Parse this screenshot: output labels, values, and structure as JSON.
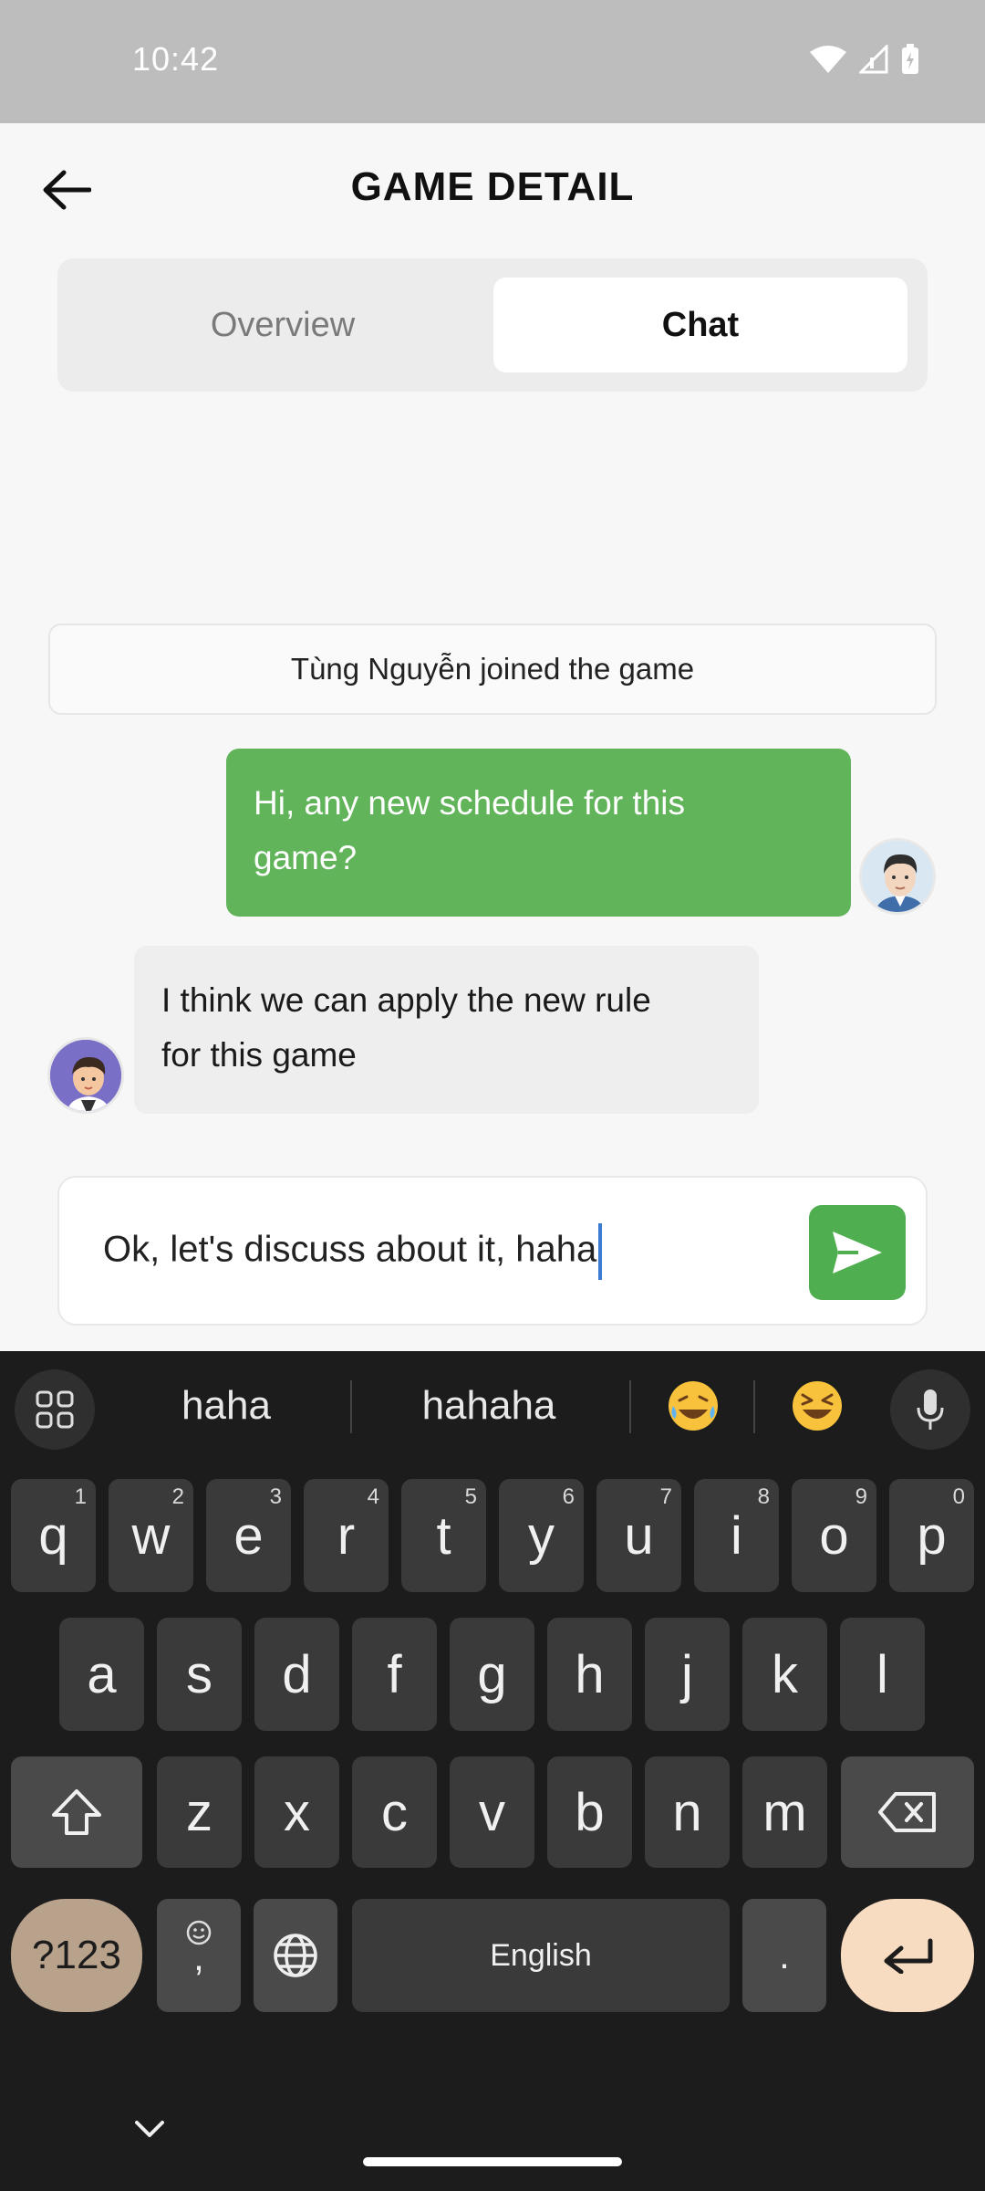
{
  "status_bar": {
    "time": "10:42"
  },
  "header": {
    "title": "GAME DETAIL"
  },
  "tabs": [
    {
      "label": "Overview"
    },
    {
      "label": "Chat"
    }
  ],
  "chat": {
    "system_message": "Tùng Nguyễn joined the game",
    "messages": [
      {
        "direction": "outgoing",
        "lines": [
          "Hi, any new schedule for this",
          "game?"
        ]
      },
      {
        "direction": "incoming",
        "lines": [
          "I think we can apply the new rule",
          "for this game"
        ]
      }
    ]
  },
  "composer": {
    "value": "Ok, let's discuss about it, haha"
  },
  "keyboard": {
    "suggestions": [
      "haha",
      "hahaha"
    ],
    "emojis": [
      "face-with-tears-of-joy",
      "grinning-squinting-face"
    ],
    "row1": [
      "q",
      "w",
      "e",
      "r",
      "t",
      "y",
      "u",
      "i",
      "o",
      "p"
    ],
    "row1_hints": [
      "1",
      "2",
      "3",
      "4",
      "5",
      "6",
      "7",
      "8",
      "9",
      "0"
    ],
    "row2": [
      "a",
      "s",
      "d",
      "f",
      "g",
      "h",
      "j",
      "k",
      "l"
    ],
    "row3": [
      "z",
      "x",
      "c",
      "v",
      "b",
      "n",
      "m"
    ],
    "sym_label": "?123",
    "comma": ",",
    "space_label": "English",
    "period": "."
  },
  "colors": {
    "outgoing_bubble": "#61b45a",
    "send_button": "#4fae4f",
    "enter_key": "#f8dcc2",
    "sym_key": "#b8a28c"
  }
}
